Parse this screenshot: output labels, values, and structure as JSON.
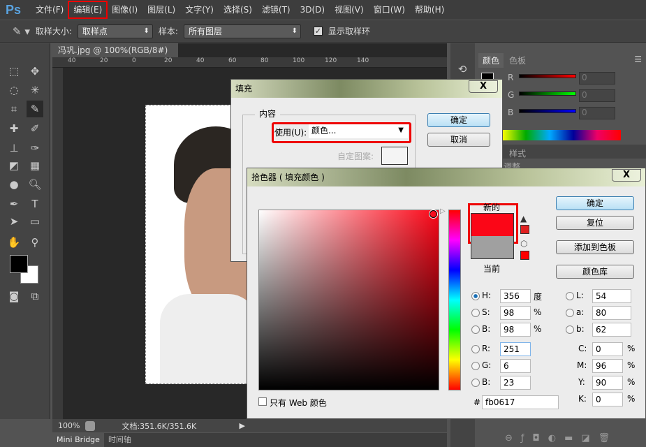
{
  "app": {
    "logo": "Ps"
  },
  "menu": [
    "文件(F)",
    "编辑(E)",
    "图像(I)",
    "图层(L)",
    "文字(Y)",
    "选择(S)",
    "滤镜(T)",
    "3D(D)",
    "视图(V)",
    "窗口(W)",
    "帮助(H)"
  ],
  "highlighted_menu": "编辑(E)",
  "options": {
    "sample_size_label": "取样大小:",
    "sample_size_value": "取样点",
    "sample_label": "样本:",
    "sample_value": "所有图层",
    "show_ring_label": "显示取样环",
    "show_ring_checked": true
  },
  "document": {
    "tab_title": "冯巩.jpg @ 100%(RGB/8#)",
    "close": "×",
    "ruler": [
      "40",
      "20",
      "0",
      "20",
      "40",
      "60",
      "80",
      "100",
      "120",
      "140"
    ]
  },
  "status": {
    "zoom": "100%",
    "doc_size": "文档:351.6K/351.6K"
  },
  "bottom_tabs": [
    "Mini Bridge",
    "时间轴"
  ],
  "color_panel": {
    "tabs": [
      "颜色",
      "色板"
    ],
    "channels": [
      {
        "label": "R",
        "value": "0",
        "color": "#ff0000"
      },
      {
        "label": "G",
        "value": "0",
        "color": "#00ff00"
      },
      {
        "label": "B",
        "value": "0",
        "color": "#0000ff"
      }
    ],
    "styles_tab": "样式",
    "adjust_label": "调整"
  },
  "fill_dialog": {
    "title": "填充",
    "close": "X",
    "group_label": "内容",
    "use_label": "使用(U):",
    "use_value": "颜色...",
    "pattern_label": "自定图案:",
    "ok": "确定",
    "cancel": "取消"
  },
  "picker": {
    "title": "拾色器 ( 填充颜色 )",
    "close": "X",
    "new_label": "新的",
    "current_label": "当前",
    "new_color": "#fb0617",
    "current_color": "#a0a0a0",
    "buttons": {
      "ok": "确定",
      "reset": "复位",
      "add_swatch": "添加到色板",
      "libraries": "颜色库"
    },
    "fields": {
      "H": "356",
      "S": "98",
      "Bv": "98",
      "R": "251",
      "G": "6",
      "B": "23",
      "L": "54",
      "a": "80",
      "b": "62",
      "C": "0",
      "M": "96",
      "Y": "90",
      "K": "0"
    },
    "units": {
      "deg": "度",
      "pct": "%"
    },
    "labels": {
      "H": "H:",
      "S": "S:",
      "Bv": "B:",
      "R": "R:",
      "G": "G:",
      "B": "B:",
      "L": "L:",
      "a": "a:",
      "b": "b:",
      "C": "C:",
      "M": "M:",
      "Y": "Y:",
      "K": "K:",
      "hash": "#"
    },
    "hex": "fb0617",
    "web_only_label": "只有 Web 颜色",
    "selected_mode": "H"
  },
  "colors": {
    "accent_red": "#e00000",
    "foreground": "#000000",
    "background": "#ffffff"
  }
}
